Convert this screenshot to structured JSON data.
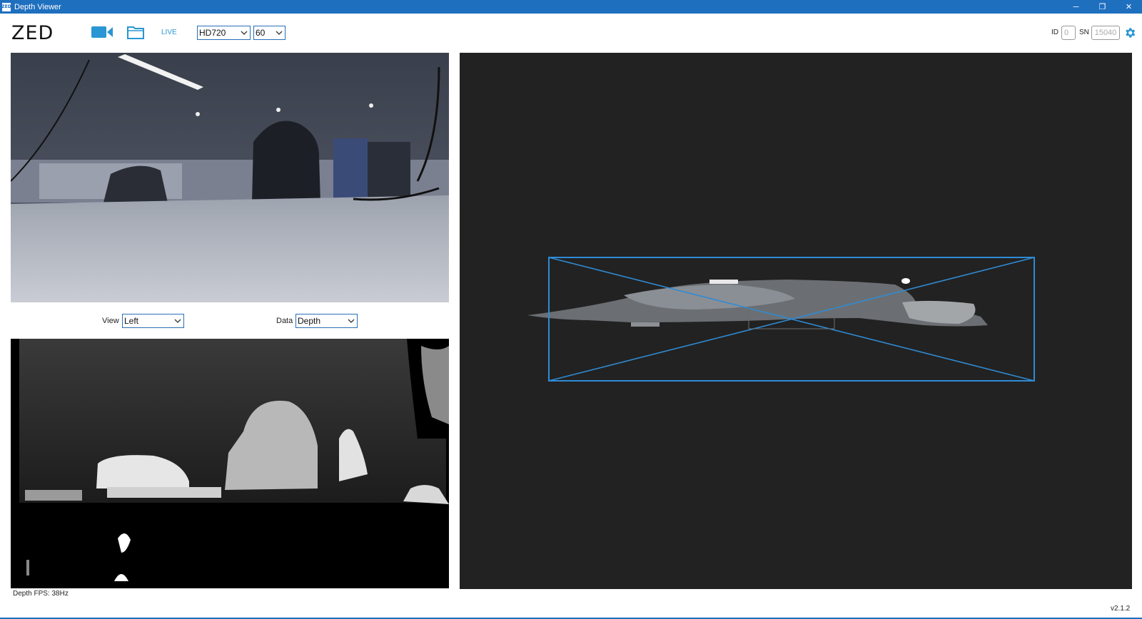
{
  "window": {
    "title": "Depth Viewer",
    "app_icon_text": "ZED",
    "controls": {
      "minimize": "─",
      "restore": "❐",
      "close": "✕"
    }
  },
  "toolbar": {
    "logo": "ZED",
    "live_label": "LIVE",
    "resolution": "HD720",
    "fps": "60",
    "id_label": "ID",
    "id_value": "0",
    "sn_label": "SN",
    "sn_value": "15040",
    "accent_color": "#2a96d4"
  },
  "controls": {
    "view_label": "View",
    "view_value": "Left",
    "data_label": "Data",
    "data_value": "Depth"
  },
  "status": {
    "depth_fps": "Depth FPS: 38Hz",
    "version": "v2.1.2"
  },
  "icons": {
    "camera": "video-camera-icon",
    "folder": "folder-icon",
    "settings": "gear-icon"
  }
}
